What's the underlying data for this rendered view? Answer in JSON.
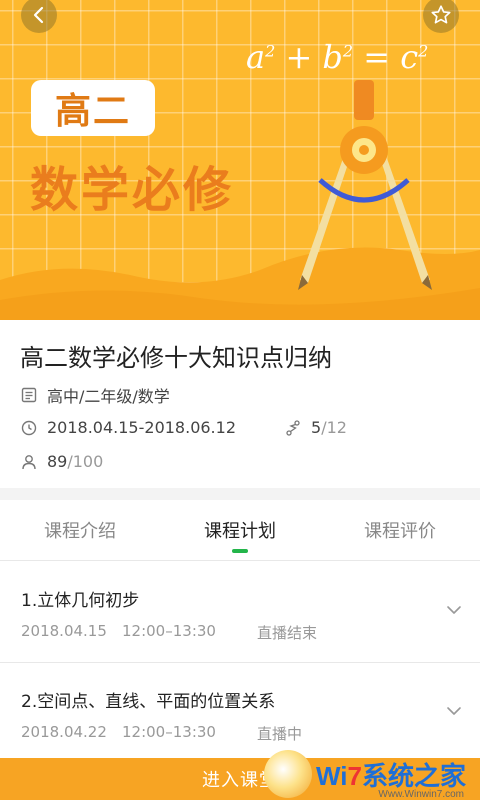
{
  "banner": {
    "grade": "高二",
    "subject": "数学必修",
    "formula_base_a": "a",
    "formula_plus": "+",
    "formula_base_b": "b",
    "formula_eq": "=",
    "formula_base_c": "c",
    "formula_exp": "2",
    "back_icon": "chevron-left-icon",
    "fav_icon": "star-outline-icon",
    "color": "#fdb92e"
  },
  "course": {
    "title": "高二数学必修十大知识点归纳",
    "category": "高中/二年级/数学",
    "date_range": "2018.04.15-2018.06.12",
    "lessons_done": "5",
    "lessons_total": "/12",
    "enrolled": "89",
    "capacity": "/100"
  },
  "tabs": [
    {
      "label": "课程介绍",
      "active": false
    },
    {
      "label": "课程计划",
      "active": true
    },
    {
      "label": "课程评价",
      "active": false
    }
  ],
  "lessons": [
    {
      "title": "1.立体几何初步",
      "date": "2018.04.15",
      "time": "12:00–13:30",
      "status": "直播结束"
    },
    {
      "title": "2.空间点、直线、平面的位置关系",
      "date": "2018.04.22",
      "time": "12:00–13:30",
      "status": "直播中"
    }
  ],
  "bottom": {
    "enter_label": "进入课堂",
    "watermark_brand": "Wi",
    "watermark_seven": "7",
    "watermark_cn": "系统之家",
    "watermark_url": "Www.Winwin7.com"
  },
  "colors": {
    "accent_green": "#23b54a",
    "enter_orange": "#f7a423",
    "title_orange": "#ea7d1d"
  }
}
